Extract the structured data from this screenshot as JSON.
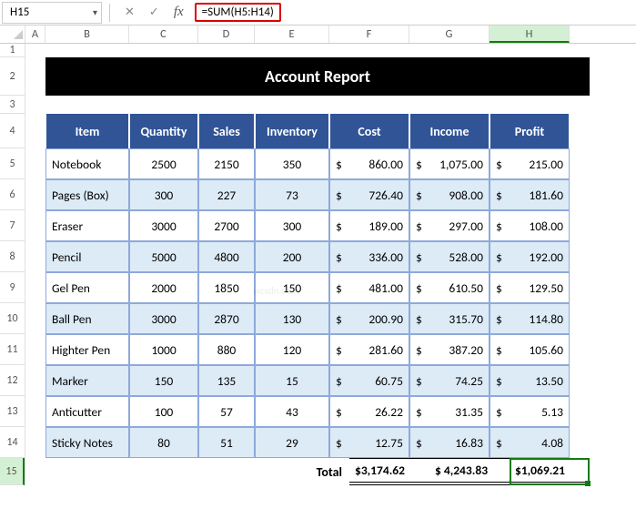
{
  "name_box": "H15",
  "formula": "=SUM(H5:H14)",
  "columns": [
    "A",
    "B",
    "C",
    "D",
    "E",
    "F",
    "G",
    "H"
  ],
  "title": "Account Report",
  "headers": {
    "item": "Item",
    "quantity": "Quantity",
    "sales": "Sales",
    "inventory": "Inventory",
    "cost": "Cost",
    "income": "Income",
    "profit": "Profit"
  },
  "rows": [
    {
      "item": "Notebook",
      "qty": "2500",
      "sales": "2150",
      "inv": "350",
      "cost": "860.00",
      "inc": "1,075.00",
      "profit": "215.00"
    },
    {
      "item": "Pages (Box)",
      "qty": "300",
      "sales": "227",
      "inv": "73",
      "cost": "726.40",
      "inc": "908.00",
      "profit": "181.60"
    },
    {
      "item": "Eraser",
      "qty": "3000",
      "sales": "2700",
      "inv": "300",
      "cost": "189.00",
      "inc": "297.00",
      "profit": "108.00"
    },
    {
      "item": "Pencil",
      "qty": "5000",
      "sales": "4800",
      "inv": "200",
      "cost": "336.00",
      "inc": "528.00",
      "profit": "192.00"
    },
    {
      "item": "Gel Pen",
      "qty": "2000",
      "sales": "1850",
      "inv": "150",
      "cost": "481.00",
      "inc": "610.50",
      "profit": "129.50"
    },
    {
      "item": "Ball Pen",
      "qty": "3000",
      "sales": "2870",
      "inv": "130",
      "cost": "200.90",
      "inc": "315.70",
      "profit": "114.80"
    },
    {
      "item": "Highter Pen",
      "qty": "1000",
      "sales": "880",
      "inv": "120",
      "cost": "281.60",
      "inc": "387.20",
      "profit": "105.60"
    },
    {
      "item": "Marker",
      "qty": "150",
      "sales": "135",
      "inv": "15",
      "cost": "60.75",
      "inc": "74.25",
      "profit": "13.50"
    },
    {
      "item": "Anticutter",
      "qty": "100",
      "sales": "57",
      "inv": "43",
      "cost": "26.22",
      "inc": "31.35",
      "profit": "5.13"
    },
    {
      "item": "Sticky Notes",
      "qty": "80",
      "sales": "51",
      "inv": "29",
      "cost": "12.75",
      "inc": "16.83",
      "profit": "4.08"
    }
  ],
  "totals": {
    "label": "Total",
    "cost": "$3,174.62",
    "income": "$ 4,243.83",
    "profit": "$1,069.21"
  },
  "currency_symbol": "$",
  "row_numbers": [
    "1",
    "2",
    "3",
    "4",
    "5",
    "6",
    "7",
    "8",
    "9",
    "10",
    "11",
    "12",
    "13",
    "14",
    "15"
  ],
  "chart_data": {
    "type": "table",
    "title": "Account Report",
    "columns": [
      "Item",
      "Quantity",
      "Sales",
      "Inventory",
      "Cost",
      "Income",
      "Profit"
    ],
    "data": [
      [
        "Notebook",
        2500,
        2150,
        350,
        860.0,
        1075.0,
        215.0
      ],
      [
        "Pages (Box)",
        300,
        227,
        73,
        726.4,
        908.0,
        181.6
      ],
      [
        "Eraser",
        3000,
        2700,
        300,
        189.0,
        297.0,
        108.0
      ],
      [
        "Pencil",
        5000,
        4800,
        200,
        336.0,
        528.0,
        192.0
      ],
      [
        "Gel Pen",
        2000,
        1850,
        150,
        481.0,
        610.5,
        129.5
      ],
      [
        "Ball Pen",
        3000,
        2870,
        130,
        200.9,
        315.7,
        114.8
      ],
      [
        "Highter Pen",
        1000,
        880,
        120,
        281.6,
        387.2,
        105.6
      ],
      [
        "Marker",
        150,
        135,
        15,
        60.75,
        74.25,
        13.5
      ],
      [
        "Anticutter",
        100,
        57,
        43,
        26.22,
        31.35,
        5.13
      ],
      [
        "Sticky Notes",
        80,
        51,
        29,
        12.75,
        16.83,
        4.08
      ]
    ],
    "totals": {
      "Cost": 3174.62,
      "Income": 4243.83,
      "Profit": 1069.21
    }
  }
}
